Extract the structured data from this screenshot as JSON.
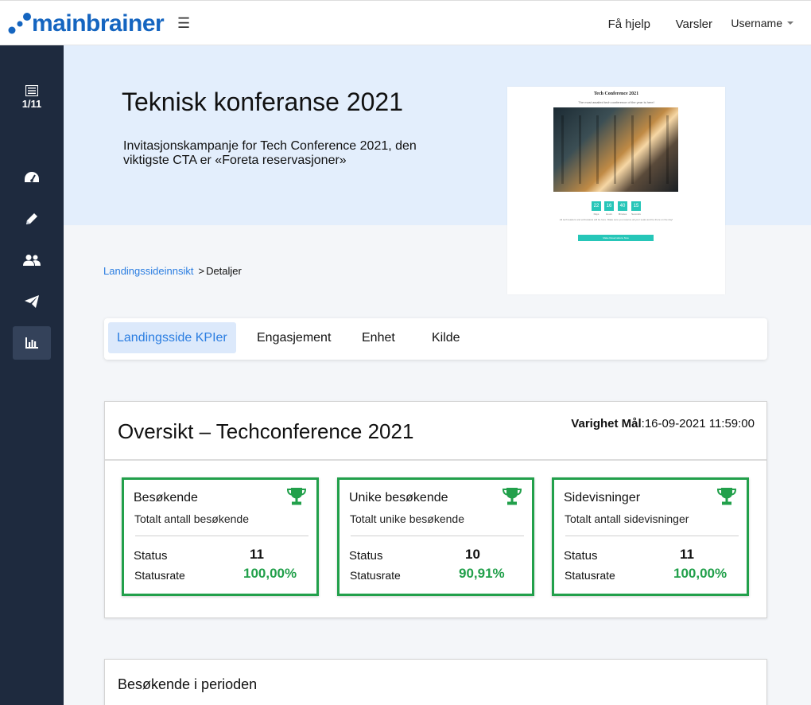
{
  "brand": {
    "name": "mainbrainer",
    "color": "#1565c0"
  },
  "header": {
    "help": "Få hjelp",
    "alerts": "Varsler",
    "user": "Username"
  },
  "sidebar": {
    "counter": "1/11",
    "items": [
      {
        "icon": "dashboard-icon"
      },
      {
        "icon": "pencil-icon"
      },
      {
        "icon": "users-icon"
      },
      {
        "icon": "send-icon"
      },
      {
        "icon": "chart-icon",
        "active": true
      }
    ]
  },
  "hero": {
    "title": "Teknisk konferanse 2021",
    "description": "Invitasjonskampanje for Tech Conference 2021, den viktigste CTA er «Foreta reservasjoner»"
  },
  "preview": {
    "title": "Tech Conference 2021",
    "subtitle": "The most awaited tech conference of the year is here!",
    "countdown": [
      {
        "value": "22",
        "label": "Days"
      },
      {
        "value": "16",
        "label": "Hours"
      },
      {
        "value": "40",
        "label": "Minutes"
      },
      {
        "value": "15",
        "label": "Seconds"
      }
    ],
    "text": "All tech leaders and enthusiasts will be here. Make sure you reserve all your seats and be there on the day!",
    "button": "Make Reservations Now"
  },
  "breadcrumb": {
    "link": "Landingssideinnsikt",
    "separator": ">",
    "current": "Detaljer"
  },
  "tabs": [
    {
      "label": "Landingsside KPIer",
      "active": true
    },
    {
      "label": "Engasjement"
    },
    {
      "label": "Enhet"
    },
    {
      "label": "Kilde"
    }
  ],
  "overview": {
    "title": "Oversikt – Techconference 2021",
    "duration_label": "Varighet Mål",
    "duration_value": ":16-09-2021 11:59:00",
    "kpis": [
      {
        "title": "Besøkende",
        "subtitle": "Totalt antall besøkende",
        "status_label": "Status",
        "status": "11",
        "rate_label": "Statusrate",
        "rate": "100,00%"
      },
      {
        "title": "Unike besøkende",
        "subtitle": "Totalt unike besøkende",
        "status_label": "Status",
        "status": "10",
        "rate_label": "Statusrate",
        "rate": "90,91%"
      },
      {
        "title": "Sidevisninger",
        "subtitle": "Totalt antall sidevisninger",
        "status_label": "Status",
        "status": "11",
        "rate_label": "Statusrate",
        "rate": "100,00%"
      }
    ],
    "accent": "#22a04b"
  },
  "period": {
    "title": "Besøkende i perioden"
  }
}
